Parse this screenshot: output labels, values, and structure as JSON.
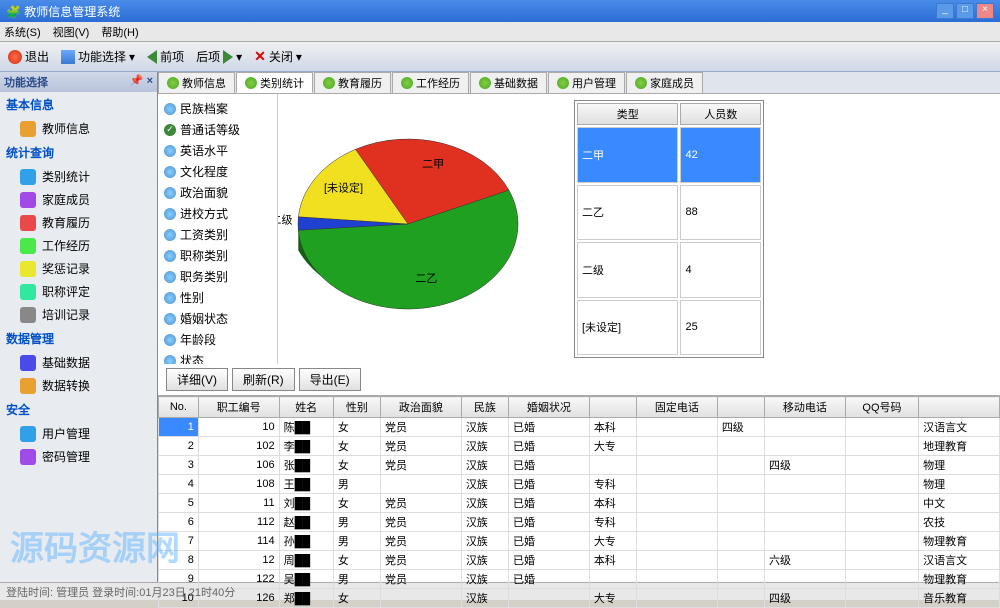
{
  "title": "教师信息管理系统",
  "menu": {
    "system": "系统(S)",
    "view": "视图(V)",
    "help": "帮助(H)"
  },
  "toolbar": {
    "exit": "退出",
    "func": "功能选择",
    "back": "前项",
    "fwd": "后项",
    "close": "关闭"
  },
  "sidebar": {
    "panel_title": "功能选择",
    "sections": {
      "basic": {
        "title": "基本信息",
        "items": [
          "教师信息"
        ]
      },
      "stats": {
        "title": "统计查询",
        "items": [
          "类别统计",
          "家庭成员",
          "教育履历",
          "工作经历",
          "奖惩记录",
          "职称评定",
          "培训记录"
        ]
      },
      "data": {
        "title": "数据管理",
        "items": [
          "基础数据",
          "数据转换"
        ]
      },
      "security": {
        "title": "安全",
        "items": [
          "用户管理",
          "密码管理"
        ]
      }
    }
  },
  "tabs": [
    "教师信息",
    "类别统计",
    "教育履历",
    "工作经历",
    "基础数据",
    "用户管理",
    "家庭成员"
  ],
  "active_tab": 1,
  "categories": [
    "民族档案",
    "普通话等级",
    "英语水平",
    "文化程度",
    "政治面貌",
    "进校方式",
    "工资类别",
    "职称类别",
    "职务类别",
    "性别",
    "婚姻状态",
    "年龄段",
    "状态"
  ],
  "selected_category": 1,
  "chart_data": {
    "type": "pie",
    "title": "",
    "series": [
      {
        "name": "二甲",
        "value": 42,
        "color": "#e03020"
      },
      {
        "name": "二乙",
        "value": 88,
        "color": "#20a020"
      },
      {
        "name": "二级",
        "value": 4,
        "color": "#2040d0"
      },
      {
        "name": "[未设定]",
        "value": 25,
        "color": "#f0e020"
      }
    ]
  },
  "summary_headers": {
    "type": "类型",
    "count": "人员数"
  },
  "buttons": {
    "detail": "详细(V)",
    "refresh": "刷新(R)",
    "export": "导出(E)"
  },
  "grid_headers": [
    "No.",
    "职工编号",
    "姓名",
    "性别",
    "政治面貌",
    "民族",
    "婚姻状况",
    "",
    "固定电话",
    "",
    "移动电话",
    "QQ号码",
    ""
  ],
  "grid_rows": [
    [
      "1",
      "10",
      "陈██",
      "女",
      "党员",
      "汉族",
      "已婚",
      "本科",
      "",
      "四级",
      "",
      "",
      "汉语言文"
    ],
    [
      "2",
      "102",
      "李██",
      "女",
      "党员",
      "汉族",
      "已婚",
      "大专",
      "",
      "",
      "",
      "",
      "地理教育"
    ],
    [
      "3",
      "106",
      "张██",
      "女",
      "党员",
      "汉族",
      "已婚",
      "",
      "",
      "",
      "四级",
      "",
      "物理"
    ],
    [
      "4",
      "108",
      "王██",
      "男",
      "",
      "汉族",
      "已婚",
      "专科",
      "",
      "",
      "",
      "",
      "物理"
    ],
    [
      "5",
      "11",
      "刘██",
      "女",
      "党员",
      "汉族",
      "已婚",
      "本科",
      "",
      "",
      "",
      "",
      "中文"
    ],
    [
      "6",
      "112",
      "赵██",
      "男",
      "党员",
      "汉族",
      "已婚",
      "专科",
      "",
      "",
      "",
      "",
      "农技"
    ],
    [
      "7",
      "114",
      "孙██",
      "男",
      "党员",
      "汉族",
      "已婚",
      "大专",
      "",
      "",
      "",
      "",
      "物理教育"
    ],
    [
      "8",
      "12",
      "周██",
      "女",
      "党员",
      "汉族",
      "已婚",
      "本科",
      "",
      "",
      "六级",
      "",
      "汉语言文"
    ],
    [
      "9",
      "122",
      "吴██",
      "男",
      "党员",
      "汉族",
      "已婚",
      "",
      "",
      "",
      "",
      "",
      "物理教育"
    ],
    [
      "10",
      "126",
      "郑██",
      "女",
      "",
      "汉族",
      "",
      "大专",
      "",
      "",
      "四级",
      "",
      "音乐教育"
    ]
  ],
  "statusbar": "登陆时间: 管理员  登录时间:01月23日 21时40分",
  "watermark": "源码资源网",
  "colors": {
    "accent": "#3a8aff"
  }
}
